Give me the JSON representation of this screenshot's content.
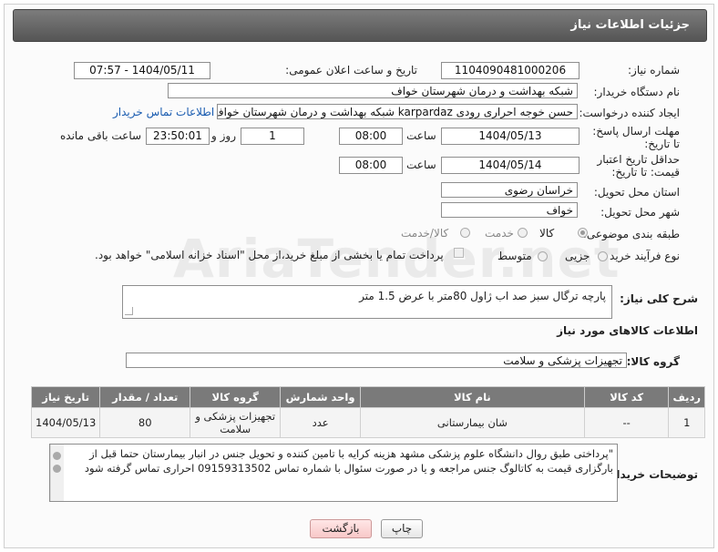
{
  "header": {
    "title": "جزئیات اطلاعات نیاز"
  },
  "fields": {
    "need_number_label": "شماره نیاز:",
    "need_number": "1104090481000206",
    "announce_label": "تاریخ و ساعت اعلان عمومی:",
    "announce_value": "1404/05/11 - 07:57",
    "buyer_org_label": "نام دستگاه خریدار:",
    "buyer_org": "شبکه بهداشت و درمان شهرستان خواف",
    "creator_label": "ایجاد کننده درخواست:",
    "creator": "حسن خوجه احراری رودی karpardaz شبکه بهداشت و درمان شهرستان خواف",
    "contact_link": "اطلاعات تماس خریدار",
    "reply_deadline_label": "مهلت ارسال پاسخ: تا تاریخ:",
    "reply_date": "1404/05/13",
    "time_label": "ساعت",
    "reply_time": "08:00",
    "days": "1",
    "days_label": "روز و",
    "remaining_time": "23:50:01",
    "remaining_label": "ساعت باقی مانده",
    "price_validity_label": "حداقل تاریخ اعتبار قیمت: تا تاریخ:",
    "price_date": "1404/05/14",
    "price_time": "08:00",
    "province_label": "استان محل تحویل:",
    "province": "خراسان رضوی",
    "city_label": "شهر محل تحویل:",
    "city": "خواف",
    "category_label": "طبقه بندی موضوعی:",
    "category_options": [
      "کالا",
      "خدمت",
      "کالا/خدمت"
    ],
    "process_label": "نوع فرآیند خرید :",
    "process_options": [
      "جزیی",
      "متوسط"
    ],
    "payment_note": "پرداخت تمام یا بخشی از مبلغ خرید،از محل \"اسناد خزانه اسلامی\" خواهد بود.",
    "general_desc_label": "شرح کلی نیاز:",
    "general_desc": "پارچه ترگال سبز صد اب ژاول 80متر با عرض  1.5 متر",
    "goods_info_title": "اطلاعات کالاهای مورد نیاز",
    "goods_group_label": "گروه کالا:",
    "goods_group": "تجهیزات پزشکی و سلامت",
    "buyer_notes_label": "توضیحات خریدار:",
    "buyer_notes": "\"پرداختی طبق روال دانشگاه علوم پزشکی مشهد  هزینه کرایه با تامین کننده و تحویل جنس در انبار بیمارستان  حتما قبل از بارگزاری قیمت به کاتالوگ جنس مراجعه و یا در صورت سئوال با  شماره تماس 09159313502 احراری تماس گرفته شود"
  },
  "table": {
    "headers": [
      "ردیف",
      "کد کالا",
      "نام کالا",
      "واحد شمارش",
      "گروه کالا",
      "تعداد / مقدار",
      "تاریخ نیاز"
    ],
    "rows": [
      [
        "1",
        "--",
        "شان بیمارستانی",
        "عدد",
        "تجهیزات پزشکی و سلامت",
        "80",
        "1404/05/13"
      ]
    ]
  },
  "buttons": {
    "print": "چاپ",
    "back": "بازگشت"
  },
  "watermark": "AriaTender.net"
}
